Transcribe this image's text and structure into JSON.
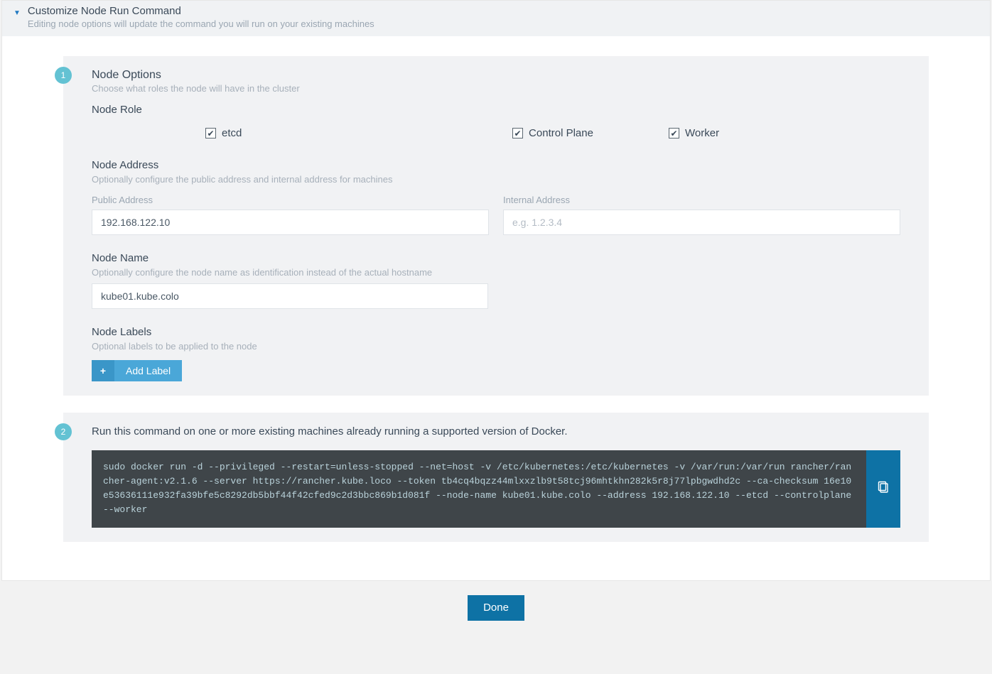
{
  "header": {
    "title": "Customize Node Run Command",
    "subtitle": "Editing node options will update the command you will run on your existing machines"
  },
  "step1": {
    "badge": "1",
    "title": "Node Options",
    "subtitle": "Choose what roles the node will have in the cluster",
    "nodeRole": {
      "label": "Node Role",
      "items": [
        {
          "label": "etcd",
          "checked": true
        },
        {
          "label": "Control Plane",
          "checked": true
        },
        {
          "label": "Worker",
          "checked": true
        }
      ]
    },
    "nodeAddress": {
      "label": "Node Address",
      "subtitle": "Optionally configure the public address and internal address for machines",
      "public": {
        "label": "Public Address",
        "value": "192.168.122.10",
        "placeholder": ""
      },
      "internal": {
        "label": "Internal Address",
        "value": "",
        "placeholder": "e.g. 1.2.3.4"
      }
    },
    "nodeName": {
      "label": "Node Name",
      "subtitle": "Optionally configure the node name as identification instead of the actual hostname",
      "value": "kube01.kube.colo"
    },
    "nodeLabels": {
      "label": "Node Labels",
      "subtitle": "Optional labels to be applied to the node",
      "addButton": "Add Label"
    }
  },
  "step2": {
    "badge": "2",
    "text": "Run this command on one or more existing machines already running a supported version of Docker.",
    "command": "sudo docker run -d --privileged --restart=unless-stopped --net=host -v /etc/kubernetes:/etc/kubernetes -v /var/run:/var/run rancher/rancher-agent:v2.1.6 --server https://rancher.kube.loco --token tb4cq4bqzz44mlxxzlb9t58tcj96mhtkhn282k5r8j77lpbgwdhd2c --ca-checksum 16e10e53636111e932fa39bfe5c8292db5bbf44f42cfed9c2d3bbc869b1d081f --node-name kube01.kube.colo --address 192.168.122.10 --etcd --controlplane --worker"
  },
  "footer": {
    "done": "Done"
  },
  "check_glyph": "✔",
  "plus_glyph": "+"
}
